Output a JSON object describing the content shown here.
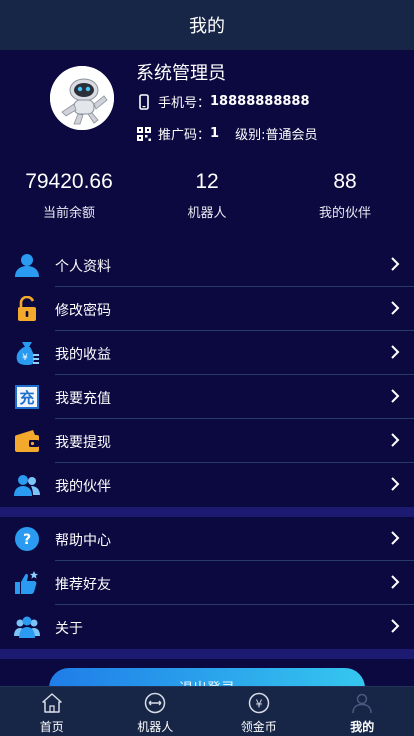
{
  "header": {
    "title": "我的"
  },
  "profile": {
    "name": "系统管理员",
    "phone_label": "手机号：",
    "phone": "18888888888",
    "promo_label": "推广码：",
    "promo_code": "1",
    "level": "级别:普通会员"
  },
  "stats": [
    {
      "value": "79420.66",
      "label": "当前余额"
    },
    {
      "value": "12",
      "label": "机器人"
    },
    {
      "value": "88",
      "label": "我的伙伴"
    }
  ],
  "menu1": [
    {
      "label": "个人资料",
      "icon": "user-icon"
    },
    {
      "label": "修改密码",
      "icon": "lock-icon"
    },
    {
      "label": "我的收益",
      "icon": "money-bag-icon"
    },
    {
      "label": "我要充值",
      "icon": "recharge-icon"
    },
    {
      "label": "我要提现",
      "icon": "wallet-icon"
    },
    {
      "label": "我的伙伴",
      "icon": "partners-icon"
    }
  ],
  "menu2": [
    {
      "label": "帮助中心",
      "icon": "help-icon"
    },
    {
      "label": "推荐好友",
      "icon": "thumbs-up-icon"
    },
    {
      "label": "关于",
      "icon": "about-icon"
    }
  ],
  "logout_label": "退出登录",
  "tabs": [
    {
      "label": "首页",
      "icon": "home-icon"
    },
    {
      "label": "机器人",
      "icon": "robot-icon"
    },
    {
      "label": "领金币",
      "icon": "coin-icon"
    },
    {
      "label": "我的",
      "icon": "person-icon",
      "active": true
    }
  ],
  "colors": {
    "background": "#0b0940",
    "bar": "#172546",
    "accent": "#1f8fe8",
    "separator": "#1d1a72"
  }
}
